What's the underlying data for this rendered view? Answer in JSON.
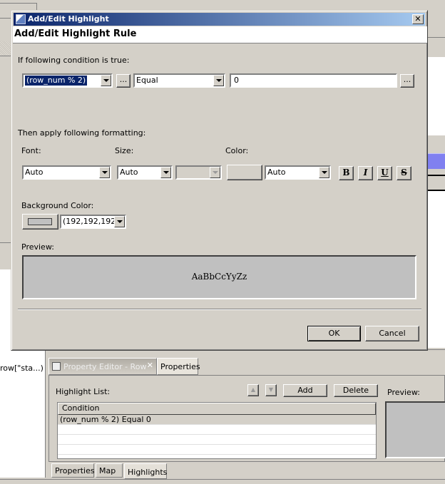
{
  "background": {
    "left_panel_text": "row[\"sta...)",
    "property_editor": {
      "tab_active": "Property Editor - Row",
      "tab_other": "Properties",
      "highlight_list_label": "Highlight List:",
      "add_label": "Add",
      "delete_label": "Delete",
      "preview_label": "Preview:",
      "column_header": "Condition",
      "rows": [
        "(row_num % 2) Equal 0",
        "",
        "",
        ""
      ],
      "bottom_tabs": [
        "Properties",
        "Map",
        "Highlights"
      ],
      "selected_bottom_tab": "Highlights"
    }
  },
  "dialog": {
    "window_title": "Add/Edit Highlight",
    "banner_title": "Add/Edit Highlight Rule",
    "condition_label": "If following condition is true:",
    "condition_expression": "(row_num % 2)",
    "operator": "Equal",
    "value": "0",
    "ellipsis": "...",
    "formatting_label": "Then apply following formatting:",
    "font_label": "Font:",
    "font_value": "Auto",
    "size_label": "Size:",
    "size_value": "Auto",
    "size_unit_value": "",
    "color_label": "Color:",
    "color_value": "Auto",
    "style_buttons": {
      "bold": "B",
      "italic": "I",
      "underline": "U",
      "strike": "S"
    },
    "background_color_label": "Background Color:",
    "background_color_value": "(192,192,192)",
    "background_color_hex": "#c0c0c0",
    "preview_label": "Preview:",
    "preview_text": "AaBbCcYyZz",
    "ok_label": "OK",
    "cancel_label": "Cancel"
  }
}
